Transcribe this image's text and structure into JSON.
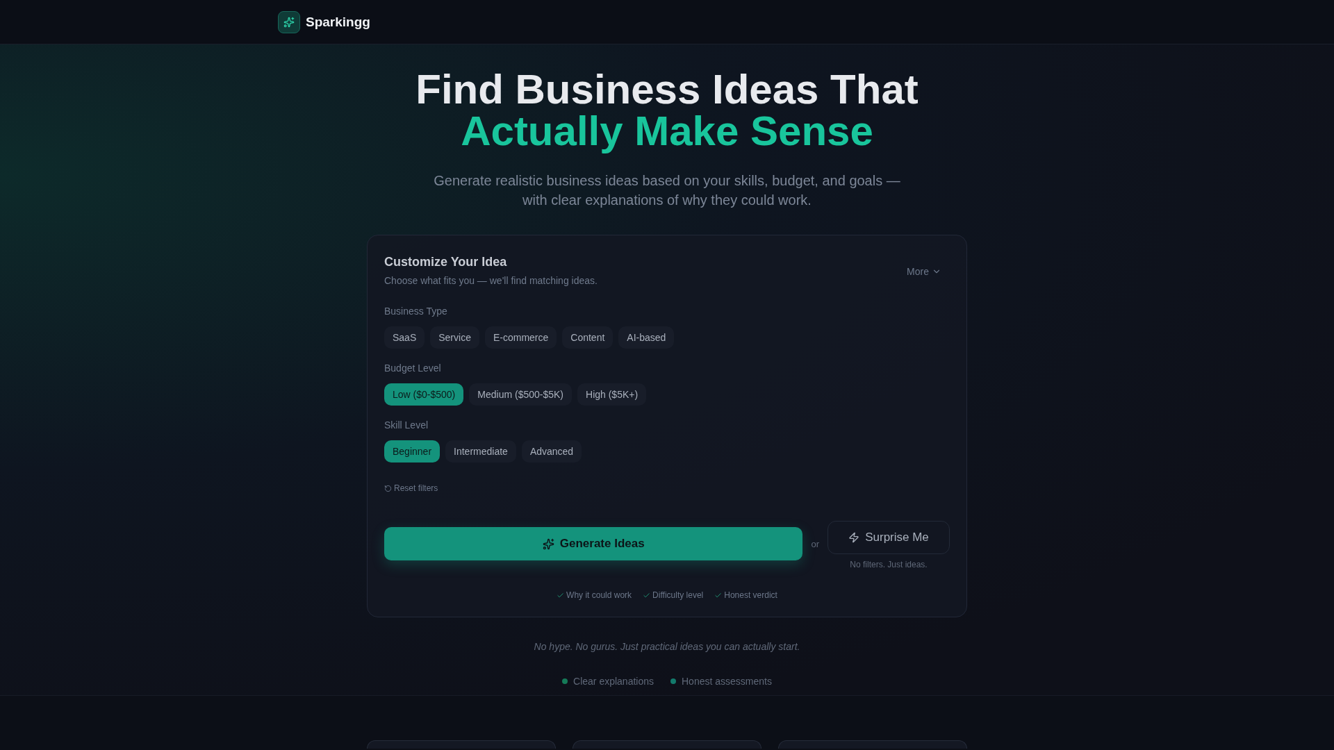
{
  "header": {
    "brand": "Sparkingg"
  },
  "hero": {
    "title_line_1": "Find Business Ideas That",
    "title_line_2": "Actually Make Sense",
    "subtitle_line_1": "Generate realistic business ideas based on your skills, budget, and goals —",
    "subtitle_line_2": "with clear explanations of why they could work."
  },
  "card": {
    "title": "Customize Your Idea",
    "subtitle": "Choose what fits you — we'll find matching ideas.",
    "more_button": "More",
    "groups": [
      {
        "label": "Business Type",
        "options": [
          {
            "label": "SaaS",
            "selected": false
          },
          {
            "label": "Service",
            "selected": false
          },
          {
            "label": "E-commerce",
            "selected": false
          },
          {
            "label": "Content",
            "selected": false
          },
          {
            "label": "AI-based",
            "selected": false
          }
        ]
      },
      {
        "label": "Budget Level",
        "options": [
          {
            "label": "Low ($0-$500)",
            "selected": true
          },
          {
            "label": "Medium ($500-$5K)",
            "selected": false
          },
          {
            "label": "High ($5K+)",
            "selected": false
          }
        ]
      },
      {
        "label": "Skill Level",
        "options": [
          {
            "label": "Beginner",
            "selected": true
          },
          {
            "label": "Intermediate",
            "selected": false
          },
          {
            "label": "Advanced",
            "selected": false
          }
        ]
      }
    ],
    "reset_link": "Reset filters",
    "generate_button": "Generate Ideas",
    "or_text": "or",
    "surprise_button": "Surprise Me",
    "surprise_caption": "No filters. Just ideas.",
    "features": [
      "Why it could work",
      "Difficulty level",
      "Honest verdict"
    ]
  },
  "tagline": "No hype. No gurus. Just practical ideas you can actually start.",
  "highlights": [
    {
      "label": "Clear explanations",
      "color": "#157a58"
    },
    {
      "label": "Honest assessments",
      "color": "#137a6c"
    }
  ]
}
